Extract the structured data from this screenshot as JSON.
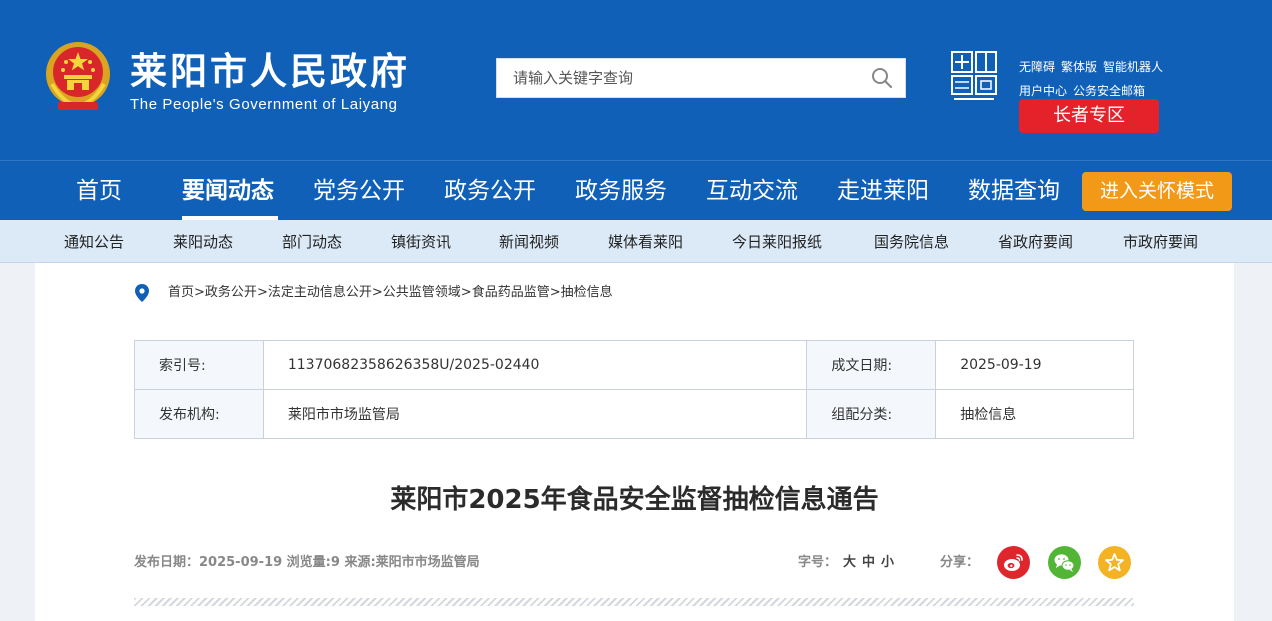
{
  "header": {
    "title": "莱阳市人民政府",
    "subtitle": "The People's Government of Laiyang",
    "search_placeholder": "请输入关键字查询",
    "util_links": [
      "无障碍",
      "繁体版",
      "智能机器人",
      "用户中心",
      "公务安全邮箱"
    ],
    "elder_zone": "长者专区",
    "colors": {
      "brand_blue": "#1060b8",
      "elder_red": "#e5212a",
      "care_orange": "#f29a17"
    }
  },
  "main_nav": {
    "items": [
      "首页",
      "要闻动态",
      "党务公开",
      "政务公开",
      "政务服务",
      "互动交流",
      "走进莱阳",
      "数据查询"
    ],
    "active": "要闻动态",
    "care_mode": "进入关怀模式"
  },
  "sub_nav": {
    "items": [
      "通知公告",
      "莱阳动态",
      "部门动态",
      "镇街资讯",
      "新闻视频",
      "媒体看莱阳",
      "今日莱阳报纸",
      "国务院信息",
      "省政府要闻",
      "市政府要闻"
    ]
  },
  "breadcrumb": [
    "首页",
    "政务公开",
    "法定主动信息公开",
    "公共监管领域",
    "食品药品监管",
    "抽检信息"
  ],
  "meta": {
    "index_label": "索引号:",
    "index_value": "11370682358626358U/2025-02440",
    "date_label": "成文日期:",
    "date_value": "2025-09-19",
    "org_label": "发布机构:",
    "org_value": "莱阳市市场监管局",
    "category_label": "组配分类:",
    "category_value": "抽检信息"
  },
  "article": {
    "title": "莱阳市2025年食品安全监督抽检信息通告",
    "info": "发布日期：2025-09-19 浏览量:9    来源:莱阳市市场监管局",
    "fontsize_label": "字号：",
    "font_sizes": [
      "大",
      "中",
      "小"
    ],
    "share_label": "分享：",
    "share_icons": [
      {
        "name": "weibo-icon",
        "color": "#e0262d"
      },
      {
        "name": "wechat-icon",
        "color": "#52b536"
      },
      {
        "name": "favorite-icon",
        "color": "#f4b325"
      }
    ]
  }
}
